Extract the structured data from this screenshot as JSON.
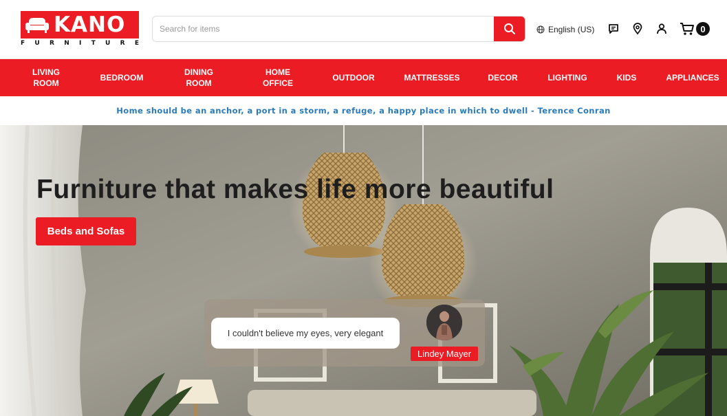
{
  "brand": {
    "name": "KANO",
    "tagline_letters": [
      "F",
      "U",
      "R",
      "N",
      "I",
      "T",
      "U",
      "R",
      "E"
    ],
    "accent": "#ec1c24"
  },
  "search": {
    "placeholder": "Search for items",
    "value": ""
  },
  "header": {
    "language": "English (US)",
    "cart_count": "0",
    "icons": [
      "search-icon",
      "globe-icon",
      "chat-icon",
      "location-pin-icon",
      "user-icon",
      "cart-icon"
    ]
  },
  "nav": {
    "items": [
      {
        "label": "LIVING\nROOM"
      },
      {
        "label": "BEDROOM"
      },
      {
        "label": "DINING\nROOM"
      },
      {
        "label": "HOME\nOFFICE"
      },
      {
        "label": "OUTDOOR"
      },
      {
        "label": "MATTRESSES"
      },
      {
        "label": "DECOR"
      },
      {
        "label": "LIGHTING"
      },
      {
        "label": "KIDS"
      },
      {
        "label": "APPLIANCES"
      }
    ]
  },
  "quote": {
    "text": "Home should be an anchor, a port in a storm, a refuge, a happy place in which to dwell - Terence Conran",
    "color": "#2a7ab8"
  },
  "hero": {
    "title": "Furniture that makes life more beautiful",
    "cta_label": "Beds and Sofas",
    "testimonial": {
      "text": "I couldn't believe my eyes, very elegant",
      "author": "Lindey Mayer"
    }
  }
}
